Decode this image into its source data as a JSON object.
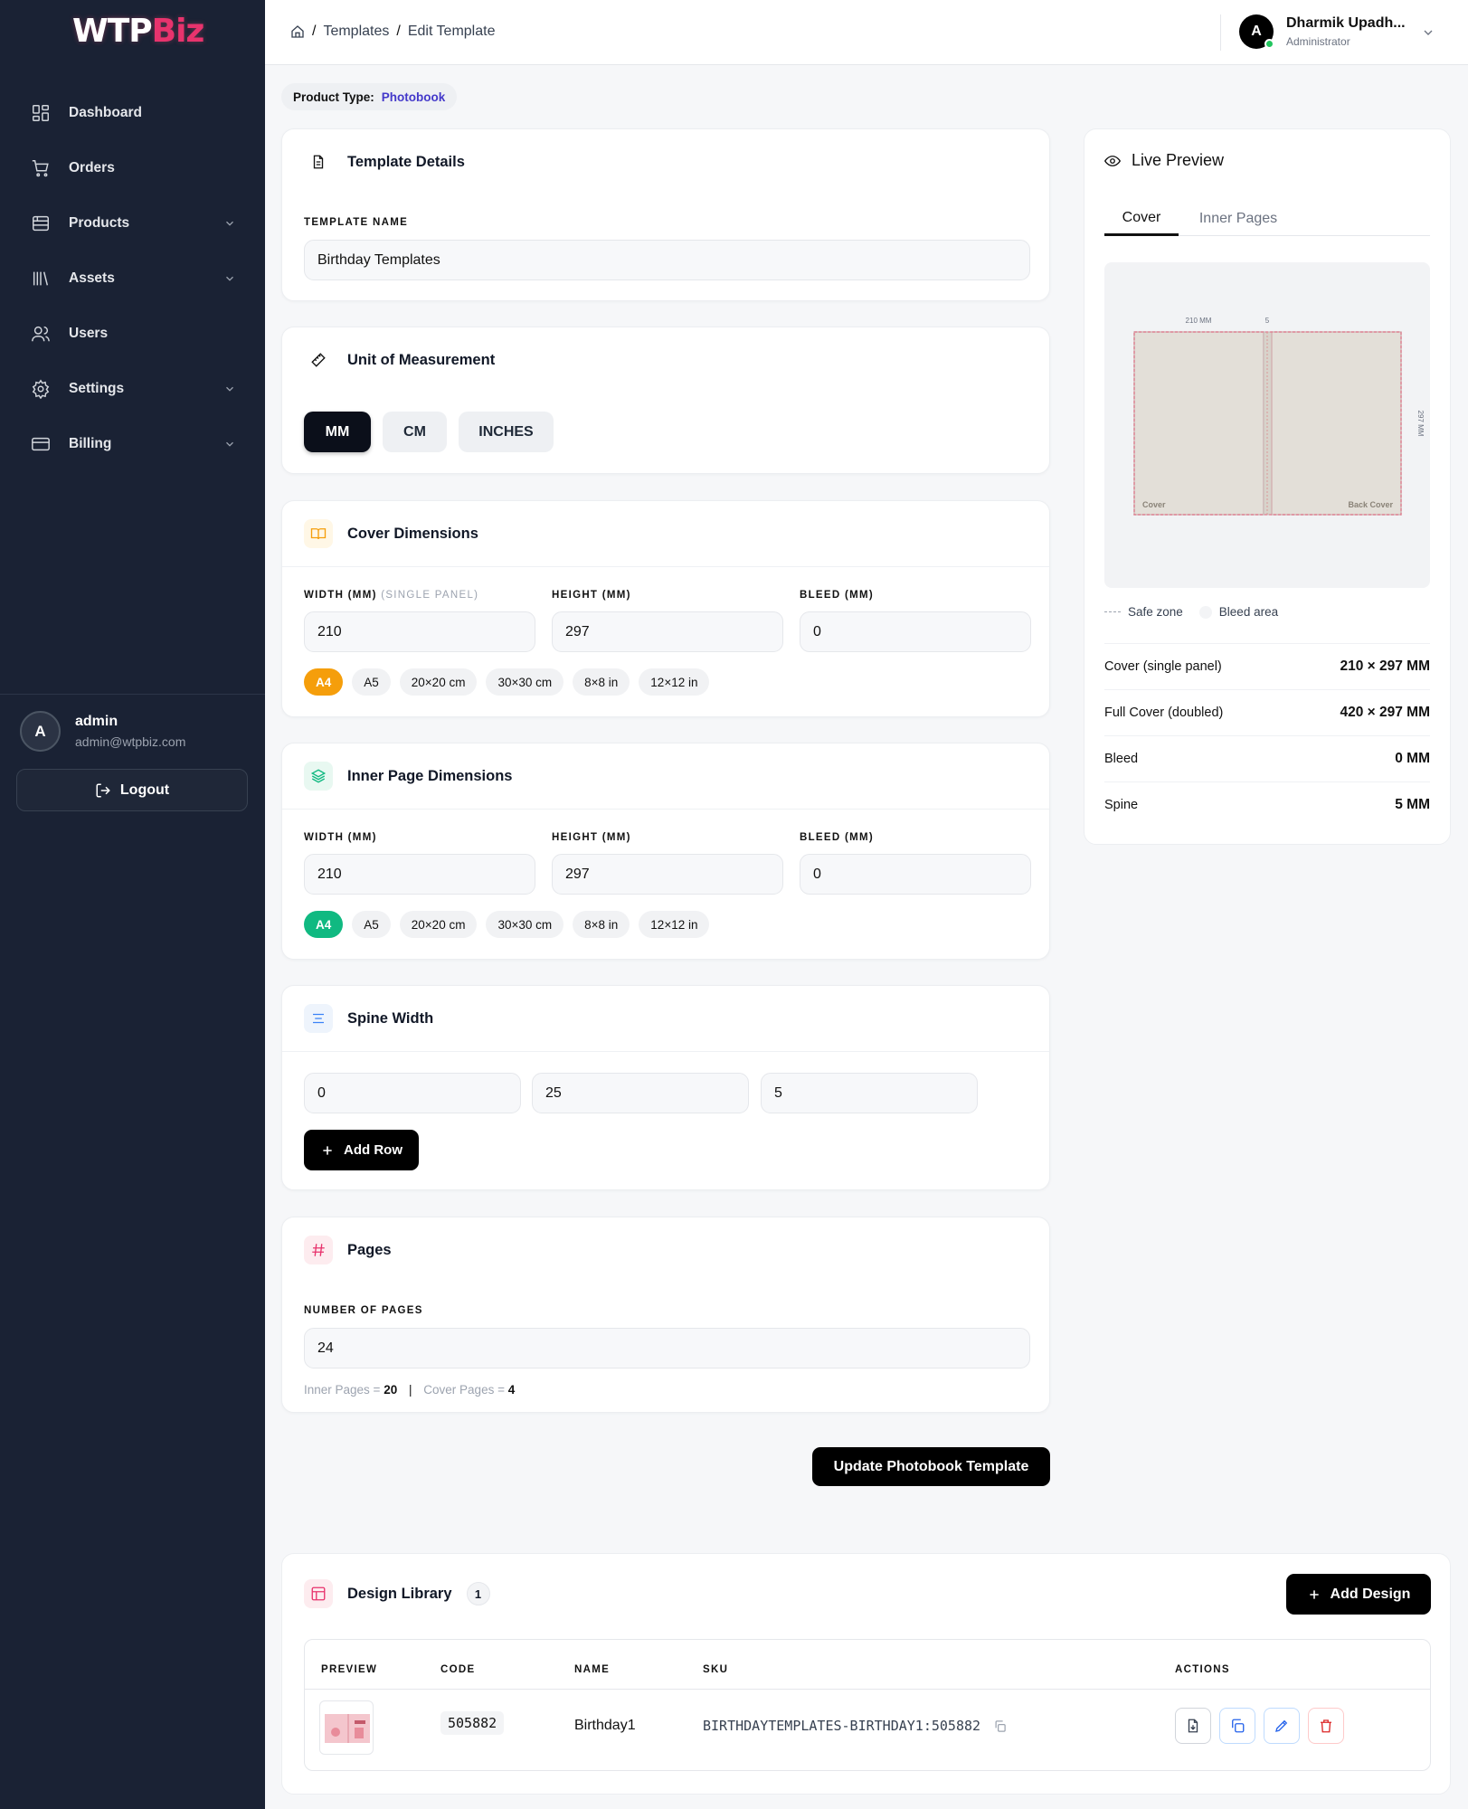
{
  "brand": {
    "part1": "WTP",
    "part2": "Biz"
  },
  "sidebar": {
    "items": [
      {
        "label": "Dashboard",
        "icon": "grid-icon"
      },
      {
        "label": "Orders",
        "icon": "cart-icon"
      },
      {
        "label": "Products",
        "icon": "box-icon",
        "expandable": true
      },
      {
        "label": "Assets",
        "icon": "library-icon",
        "expandable": true
      },
      {
        "label": "Users",
        "icon": "users-icon"
      },
      {
        "label": "Settings",
        "icon": "gear-icon",
        "expandable": true
      },
      {
        "label": "Billing",
        "icon": "credit-card-icon",
        "expandable": true
      }
    ],
    "user": {
      "initial": "A",
      "name": "admin",
      "email": "admin@wtpbiz.com"
    },
    "logout_label": "Logout"
  },
  "topbar": {
    "breadcrumb": [
      "Templates",
      "Edit Template"
    ],
    "user": {
      "initial": "A",
      "name": "Dharmik Upadh...",
      "role": "Administrator"
    }
  },
  "product_type": {
    "label": "Product Type:",
    "value": "Photobook"
  },
  "template_details": {
    "title": "Template Details",
    "field_label": "TEMPLATE NAME",
    "value": "Birthday Templates"
  },
  "unit": {
    "title": "Unit of Measurement",
    "options": [
      "MM",
      "CM",
      "INCHES"
    ],
    "selected": "MM"
  },
  "cover": {
    "title": "Cover Dimensions",
    "width_label": "WIDTH (MM)",
    "width_sub": "(SINGLE PANEL)",
    "height_label": "HEIGHT (MM)",
    "bleed_label": "BLEED (MM)",
    "width": "210",
    "height": "297",
    "bleed": "0",
    "presets": [
      "A4",
      "A5",
      "20×20 cm",
      "30×30 cm",
      "8×8 in",
      "12×12 in"
    ],
    "selected_preset": "A4"
  },
  "inner": {
    "title": "Inner Page Dimensions",
    "width_label": "WIDTH (MM)",
    "height_label": "HEIGHT (MM)",
    "bleed_label": "BLEED (MM)",
    "width": "210",
    "height": "297",
    "bleed": "0",
    "presets": [
      "A4",
      "A5",
      "20×20 cm",
      "30×30 cm",
      "8×8 in",
      "12×12 in"
    ],
    "selected_preset": "A4"
  },
  "spine": {
    "title": "Spine Width",
    "values": [
      "0",
      "25",
      "5"
    ],
    "add_row_label": "Add Row"
  },
  "pages": {
    "title": "Pages",
    "field_label": "NUMBER OF PAGES",
    "value": "24",
    "inner_label": "Inner Pages =",
    "inner_value": "20",
    "cover_label": "Cover Pages =",
    "cover_value": "4"
  },
  "update_label": "Update Photobook Template",
  "preview": {
    "title": "Live Preview",
    "tabs": [
      "Cover",
      "Inner Pages"
    ],
    "active_tab": "Cover",
    "canvas": {
      "width_label": "210 MM",
      "spine_label": "5",
      "height_label": "297 MM",
      "front_label": "Cover",
      "back_label": "Back Cover"
    },
    "legend": {
      "safe": "Safe zone",
      "bleed": "Bleed area"
    },
    "stats": [
      {
        "label": "Cover (single panel)",
        "value": "210 × 297 MM"
      },
      {
        "label": "Full Cover (doubled)",
        "value": "420 × 297 MM"
      },
      {
        "label": "Bleed",
        "value": "0 MM"
      },
      {
        "label": "Spine",
        "value": "5 MM"
      }
    ]
  },
  "library": {
    "title": "Design Library",
    "count": "1",
    "add_label": "Add Design",
    "columns": [
      "PREVIEW",
      "CODE",
      "NAME",
      "SKU",
      "ACTIONS"
    ],
    "rows": [
      {
        "code": "505882",
        "name": "Birthday1",
        "sku": "BIRTHDAYTEMPLATES-BIRTHDAY1:505882"
      }
    ]
  },
  "colors": {
    "sidebar_bg": "#1a2234",
    "brand_accent": "#e8336d",
    "link": "#4338ca",
    "preset_cover": "#f59e0b",
    "preset_inner": "#10b981"
  }
}
